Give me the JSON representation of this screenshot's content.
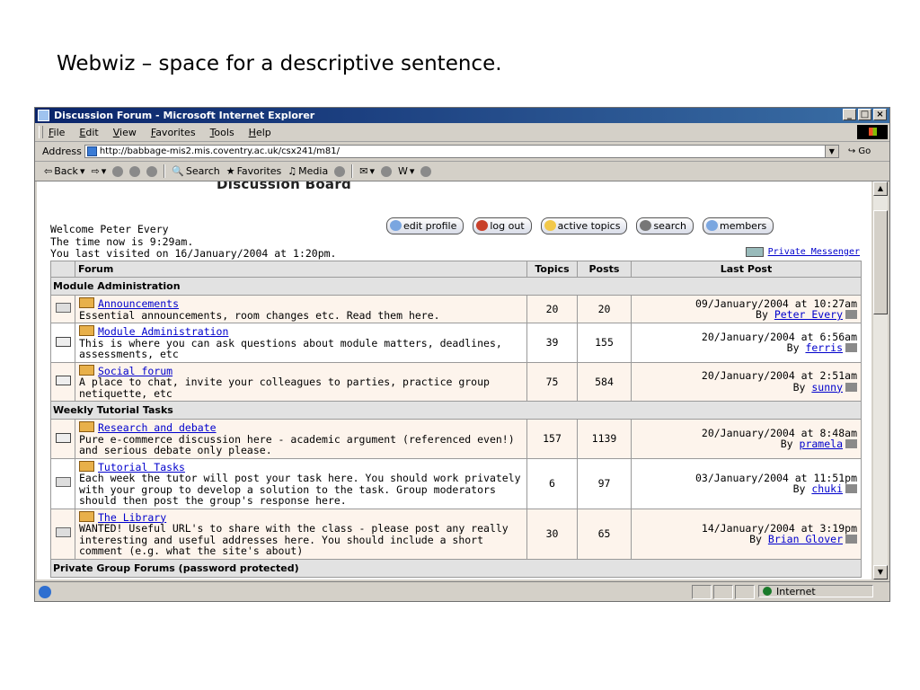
{
  "slide": {
    "caption": "Webwiz – space for a descriptive sentence."
  },
  "window": {
    "title": "Discussion Forum - Microsoft Internet Explorer",
    "minimize": "_",
    "maximize": "□",
    "close": "×"
  },
  "menu": [
    "File",
    "Edit",
    "View",
    "Favorites",
    "Tools",
    "Help"
  ],
  "address": {
    "label": "Address",
    "url": "http://babbage-mis2.mis.coventry.ac.uk/csx241/m81/",
    "go": "Go"
  },
  "toolbar": {
    "back": "Back",
    "search": "Search",
    "favorites": "Favorites",
    "media": "Media"
  },
  "board": {
    "title": "Discussion Board",
    "welcome": "Welcome Peter Every",
    "time_now": "The time now is 9:29am.",
    "last_visit": "You last visited on 16/January/2004 at 1:20pm.",
    "buttons": [
      "edit profile",
      "log out",
      "active topics",
      "search",
      "members"
    ],
    "private_messenger": "Private Messenger"
  },
  "table": {
    "headers": {
      "forum": "Forum",
      "topics": "Topics",
      "posts": "Posts",
      "last_post": "Last Post"
    },
    "categories": [
      {
        "name": "Module Administration",
        "forums": [
          {
            "name": "Announcements",
            "desc": "Essential announcements, room changes etc. Read them here.",
            "topics": "20",
            "posts": "20",
            "date": "09/January/2004 at 10:27am",
            "by": "Peter Every",
            "new": false
          },
          {
            "name": "Module Administration",
            "desc": "This is where you can ask questions about module matters, deadlines, assessments, etc",
            "topics": "39",
            "posts": "155",
            "date": "20/January/2004 at 6:56am",
            "by": "ferris",
            "new": true
          },
          {
            "name": "Social forum",
            "desc": "A place to chat, invite your colleagues to parties, practice group netiquette, etc",
            "topics": "75",
            "posts": "584",
            "date": "20/January/2004 at 2:51am",
            "by": "sunny",
            "new": true
          }
        ]
      },
      {
        "name": "Weekly Tutorial Tasks",
        "forums": [
          {
            "name": "Research and debate",
            "desc": "Pure e-commerce discussion here - academic argument (referenced even!) and serious debate only please.",
            "topics": "157",
            "posts": "1139",
            "date": "20/January/2004 at 8:48am",
            "by": "pramela",
            "new": true
          },
          {
            "name": "Tutorial Tasks",
            "desc": "Each week the tutor will post your task here. You should work privately with your group to develop a solution to the task. Group moderators should then post the group's response here.",
            "topics": "6",
            "posts": "97",
            "date": "03/January/2004 at 11:51pm",
            "by": "chuki",
            "new": false
          },
          {
            "name": "The Library",
            "desc": "WANTED! Useful URL's to share with the class - please post any really interesting and useful addresses here. You should include a short comment (e.g. what the site's about)",
            "topics": "30",
            "posts": "65",
            "date": "14/January/2004 at 3:19pm",
            "by": "Brian Glover",
            "new": false
          }
        ]
      },
      {
        "name": "Private Group Forums (password protected)",
        "forums": []
      }
    ],
    "by_prefix": "By"
  },
  "status": {
    "zone": "Internet"
  },
  "colors": {
    "title_bar": "#0a246a",
    "link": "#0000cc",
    "row_bg": "#fdf4ec"
  }
}
